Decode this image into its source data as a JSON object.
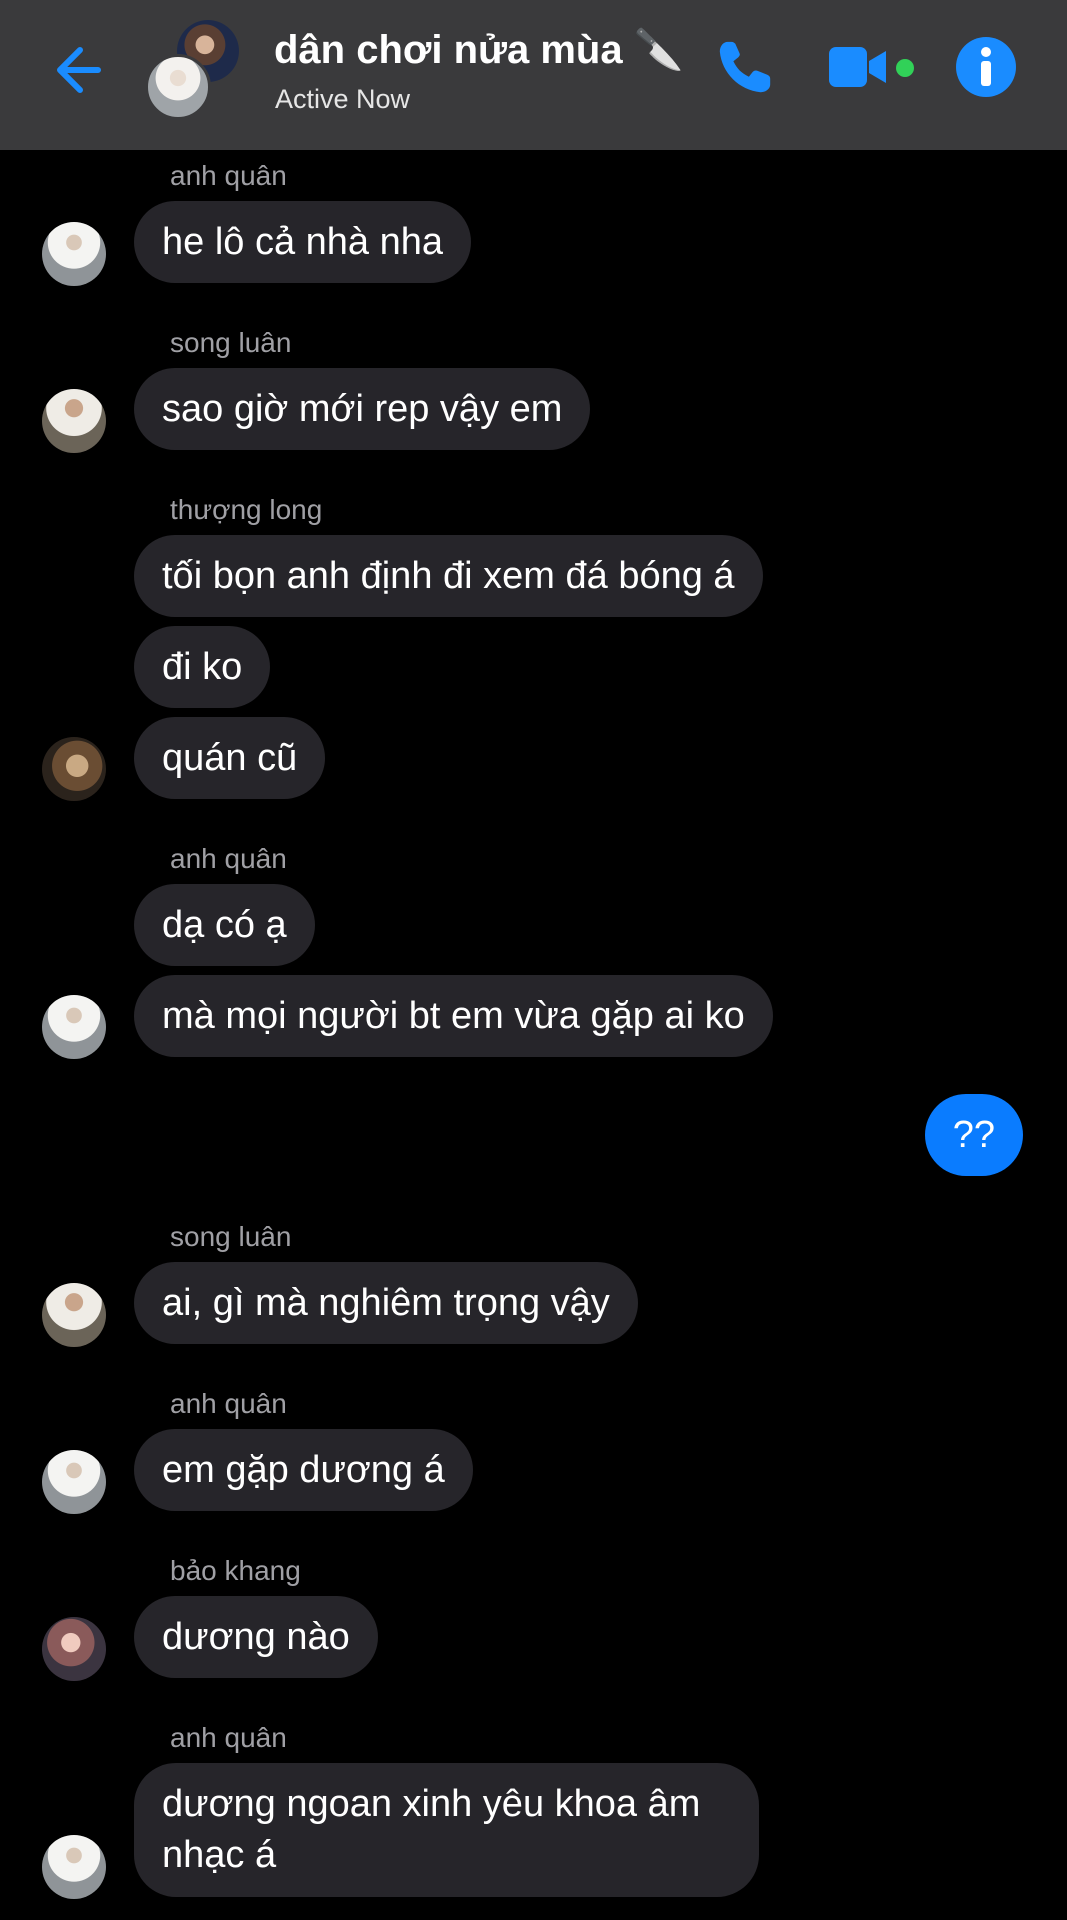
{
  "header": {
    "title": "dân chơi nửa mùa",
    "title_emoji": "🔪",
    "status": "Active Now",
    "colors": {
      "accent": "#0a84ff",
      "online": "#31d158",
      "background": "#3a3a3c"
    }
  },
  "messages": [
    {
      "sender": "anh quân",
      "text": "he lô cả nhà nha"
    },
    {
      "sender": "song luân",
      "text": "sao giờ mới rep vậy em"
    },
    {
      "sender": "thượng long",
      "texts": [
        "tối bọn anh định đi xem đá bóng á",
        "đi ko",
        "quán cũ"
      ]
    },
    {
      "sender": "anh quân",
      "texts": [
        "dạ có ạ",
        "mà mọi người bt em vừa gặp ai ko"
      ]
    },
    {
      "sender": "me",
      "text": "??"
    },
    {
      "sender": "song luân",
      "text": "ai, gì mà nghiêm trọng vậy"
    },
    {
      "sender": "anh quân",
      "text": "em gặp dương á"
    },
    {
      "sender": "bảo khang",
      "text": "dương nào"
    },
    {
      "sender": "anh quân",
      "text": "dương ngoan xinh yêu khoa âm nhạc á"
    }
  ],
  "colors": {
    "incoming_bubble": "#26252a",
    "outgoing_bubble": "#0a7cff",
    "sender_label": "#a0a0a5",
    "background": "#000000"
  }
}
